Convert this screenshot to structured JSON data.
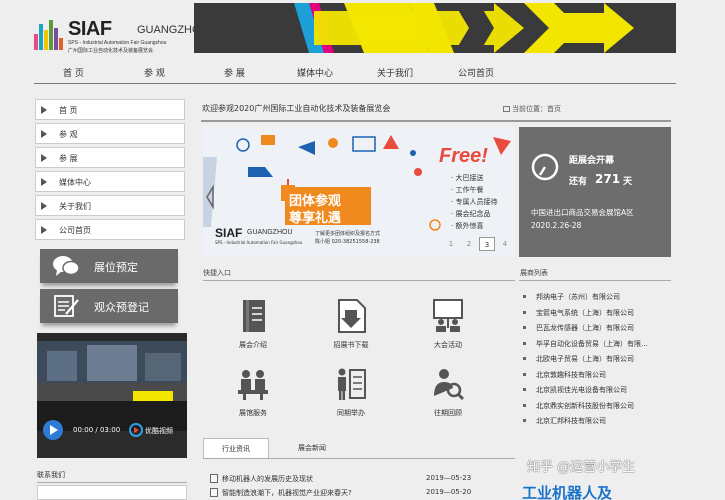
{
  "header": {
    "logo": {
      "main": "SIAF",
      "city": "GUANGZHOU",
      "sub_en": "SPS - Industrial Automation Fair Guangzhou",
      "sub_cn": "广州国际工业自动化技术及装备展览会"
    }
  },
  "nav": [
    "首 页",
    "参 观",
    "参 展",
    "媒体中心",
    "关于我们",
    "公司首页"
  ],
  "sidebar": {
    "menu": [
      "首 页",
      "参 观",
      "参 展",
      "媒体中心",
      "关于我们",
      "公司首页"
    ],
    "buttons": [
      {
        "label": "展位预定",
        "icon": "chat-bubbles-icon"
      },
      {
        "label": "观众预登记",
        "icon": "register-form-icon"
      }
    ],
    "video": {
      "time": "00:00 / 03:00",
      "brand": "优酷视频"
    },
    "contact_title": "联系我们"
  },
  "main": {
    "welcome": "欢迎参观2020广州国际工业自动化技术及装备展览会",
    "location_label": "当前位置：",
    "location": "首页"
  },
  "slider": {
    "free": "Free!",
    "headline1": "团体参观",
    "headline2": "尊享礼遇",
    "perks": [
      "· 大巴接送",
      "· 工作午餐",
      "· 专属人员接待",
      "· 展会纪念品",
      "· 额外惊喜"
    ],
    "contact1": "了解更多团体组织及报名方式",
    "contact2": "陈小姐 020-38251558-238",
    "logo_main": "SIAF",
    "logo_city": "GUANGZHOU",
    "logo_sub": "SPS - Industrial Automation Fair Guangzhou",
    "pages": [
      "1",
      "2",
      "3",
      "4"
    ],
    "active_page": 3
  },
  "countdown": {
    "label": "距展会开幕",
    "prefix": "还有",
    "days": "271",
    "unit": "天",
    "venue": "中国进出口商品交易会展馆A区",
    "dates": "2020.2.26-28"
  },
  "quick_links": {
    "title": "快捷入口",
    "items": [
      {
        "label": "展会介绍",
        "icon": "book-icon"
      },
      {
        "label": "招展书下载",
        "icon": "download-document-icon"
      },
      {
        "label": "大会活动",
        "icon": "presentation-icon"
      },
      {
        "label": "展馆服务",
        "icon": "service-people-icon"
      },
      {
        "label": "同期举办",
        "icon": "concurrent-events-icon"
      },
      {
        "label": "往期回顾",
        "icon": "review-search-icon"
      }
    ]
  },
  "exhibitors": {
    "title": "展商列表",
    "items": [
      "邦纳电子（苏州）有限公司",
      "宝箭电气系统（上海）有限公司",
      "巴瓦龙传感器（上海）有限公司",
      "毕孚自动化设备贸易（上海）有限...",
      "北欧电子贸易（上海）有限公司",
      "北京敦趣科技有限公司",
      "北京凯视佳光电设备有限公司",
      "北京鼎实创新科技股份有限公司",
      "北京汇邦科技有限公司"
    ]
  },
  "news": {
    "tabs": [
      "行业资讯",
      "展会新闻"
    ],
    "active_tab": 0,
    "items": [
      {
        "title": "移动机器人的发展历史及现状",
        "date": "2019—05-23"
      },
      {
        "title": "智能制造浪潮下，机器视觉产业迎来春天?",
        "date": "2019—05-20"
      }
    ]
  },
  "promo_partial": "工业机器人及",
  "watermark": "知乎 @运营小学生",
  "colors": {
    "banner_yellow": "#f2e600",
    "banner_bg": "#3a3a3a",
    "slider_orange": "#f08a1e",
    "slider_blue": "#1d62b0",
    "promo_blue": "#1a73c9",
    "panel_gray": "#6d6d6d"
  }
}
